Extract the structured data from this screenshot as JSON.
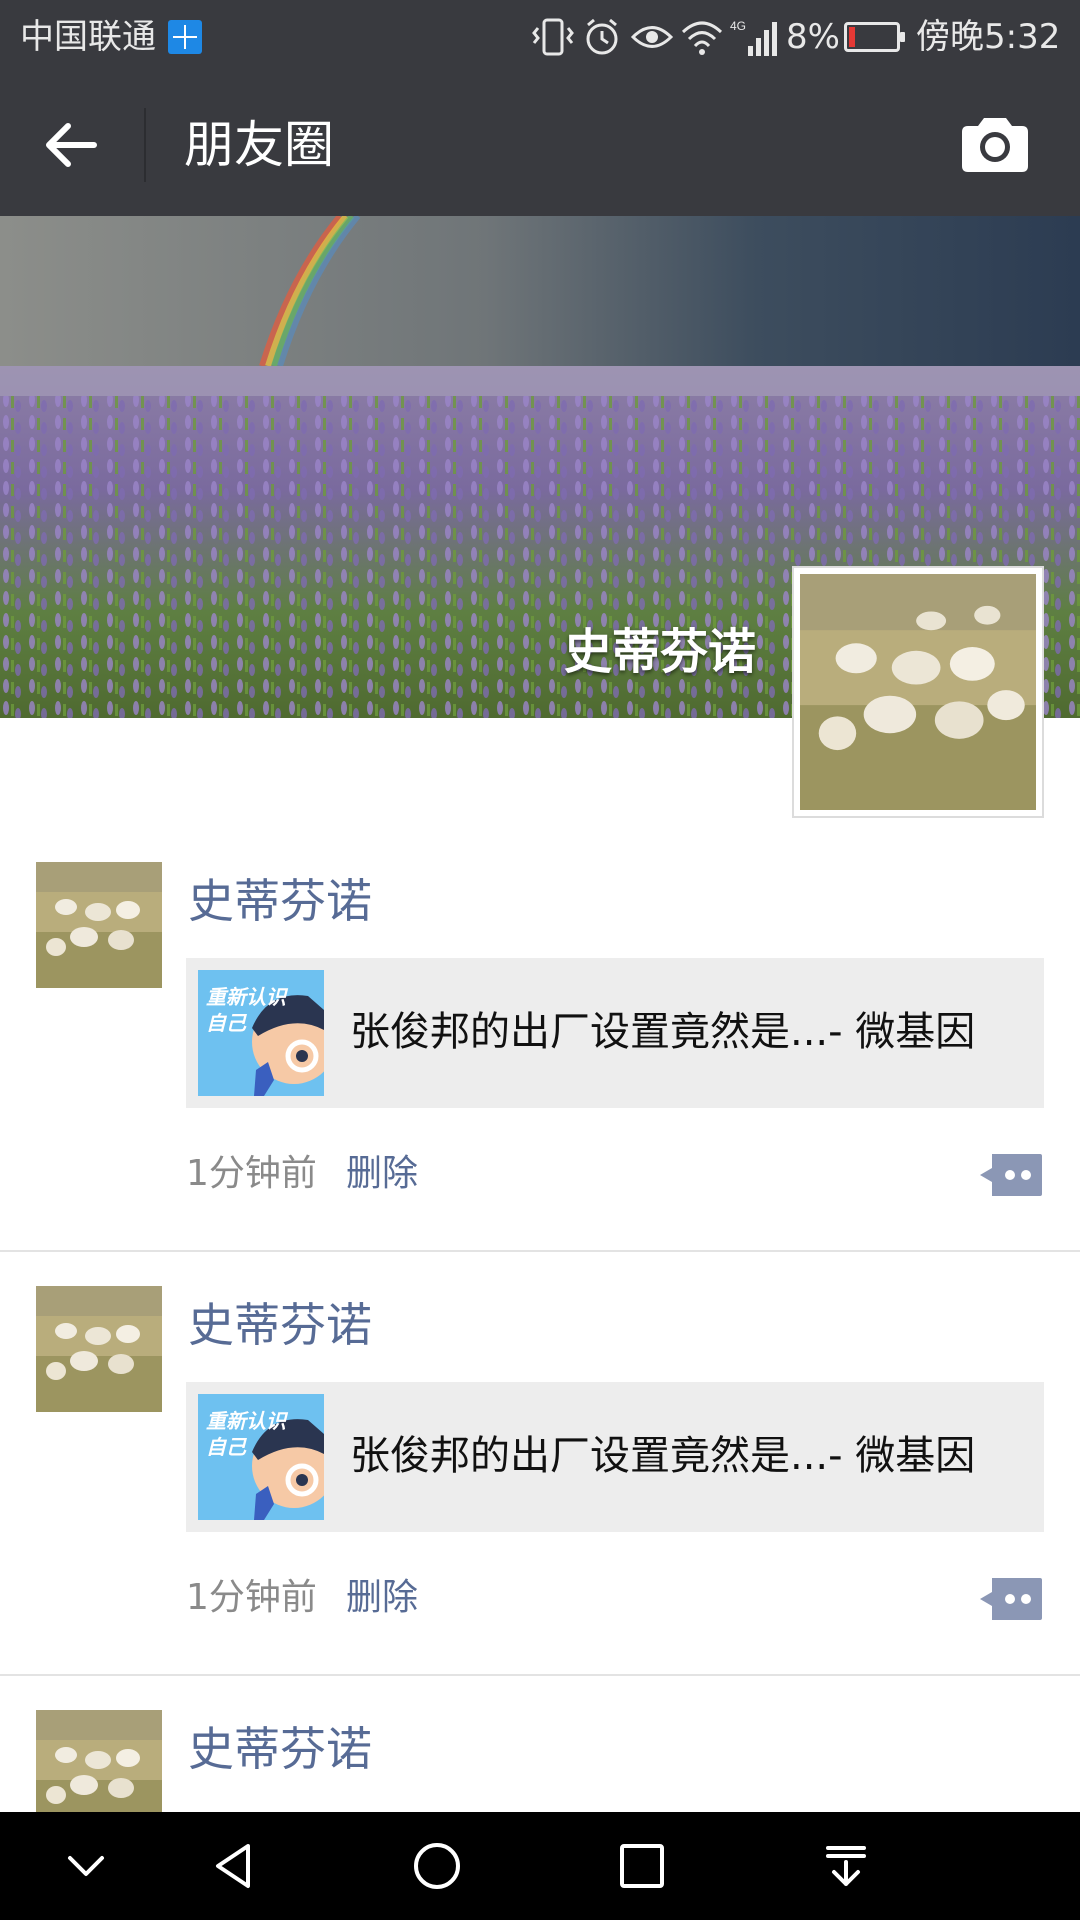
{
  "status_bar": {
    "carrier": "中国联通",
    "battery_percent": "8%",
    "battery_level": 0.08,
    "time": "傍晚5:32",
    "network": "4G",
    "icons": [
      "windows-logo-icon",
      "vibrate-icon",
      "alarm-icon",
      "eye-icon",
      "wifi-icon",
      "signal-icon",
      "battery-icon"
    ]
  },
  "nav": {
    "title": "朋友圈",
    "back_icon": "arrow-left-icon",
    "camera_icon": "camera-icon"
  },
  "profile": {
    "name": "史蒂芬诺"
  },
  "posts": [
    {
      "author": "史蒂芬诺",
      "link_thumb_text": "重新认识\n自己",
      "link_title": "张俊邦的出厂设置竟然是...- 微基因",
      "time": "1分钟前",
      "delete_label": "删除"
    },
    {
      "author": "史蒂芬诺",
      "link_thumb_text": "重新认识\n自己",
      "link_title": "张俊邦的出厂设置竟然是...- 微基因",
      "time": "1分钟前",
      "delete_label": "删除"
    },
    {
      "author": "史蒂芬诺"
    }
  ],
  "colors": {
    "header_bg": "#393a3f",
    "name_link": "#576b95",
    "card_bg": "#ededed",
    "meta_gray": "#8a8a8a"
  }
}
